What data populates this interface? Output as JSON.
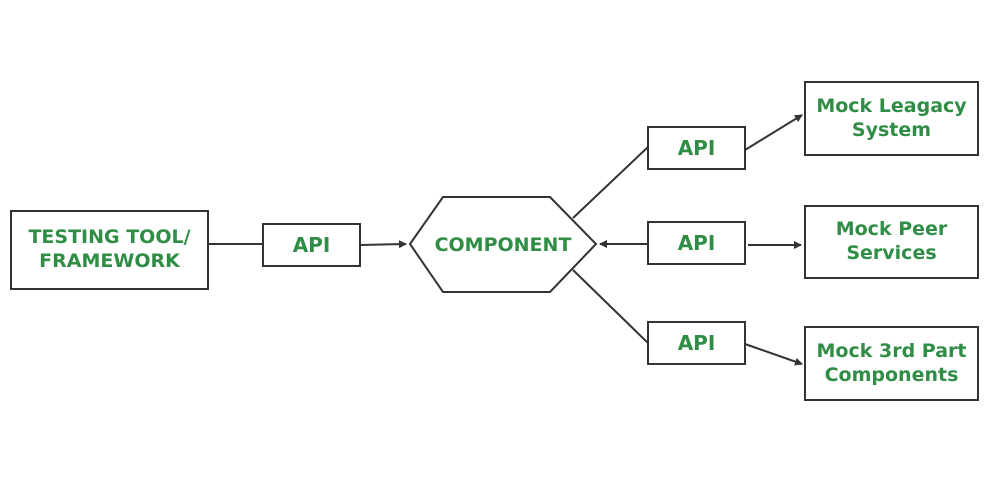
{
  "colors": {
    "text": "#2f8d46",
    "stroke": "#333333",
    "background": "#ffffff"
  },
  "nodes": {
    "testing_tool": "TESTING TOOL/\nFRAMEWORK",
    "api_main": "API",
    "component": "COMPONENT",
    "api_top": "API",
    "api_mid": "API",
    "api_bottom": "API",
    "mock_legacy": "Mock Leagacy\nSystem",
    "mock_peer": "Mock Peer\nServices",
    "mock_third_party": "Mock 3rd Part\nComponents"
  },
  "edges": [
    {
      "from": "testing_tool",
      "to": "api_main",
      "arrow": false
    },
    {
      "from": "api_main",
      "to": "component",
      "arrow": true
    },
    {
      "from": "component",
      "to": "api_top",
      "arrow": false
    },
    {
      "from": "api_mid",
      "to": "component",
      "arrow": true
    },
    {
      "from": "component",
      "to": "api_bottom",
      "arrow": false
    },
    {
      "from": "api_top",
      "to": "mock_legacy",
      "arrow": true
    },
    {
      "from": "api_mid",
      "to": "mock_peer",
      "arrow": true
    },
    {
      "from": "api_bottom",
      "to": "mock_third_party",
      "arrow": true
    }
  ]
}
